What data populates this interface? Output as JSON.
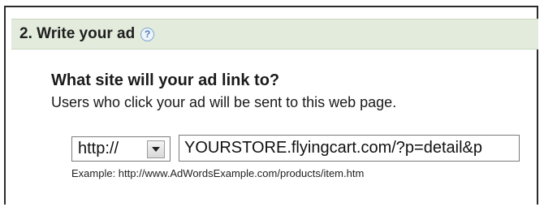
{
  "section": {
    "title": "2. Write your ad",
    "help_glyph": "?"
  },
  "question": "What site will your ad link to?",
  "subtitle": "Users who click your ad will be sent to this web page.",
  "protocol": {
    "selected": "http://"
  },
  "url": {
    "value": "YOURSTORE.flyingcart.com/?p=detail&p"
  },
  "example": "Example: http://www.AdWordsExample.com/products/item.htm",
  "colors": {
    "header_bg": "#e3ecdc",
    "help_icon": "#4a7fbf",
    "border": "#2b2b2b"
  }
}
